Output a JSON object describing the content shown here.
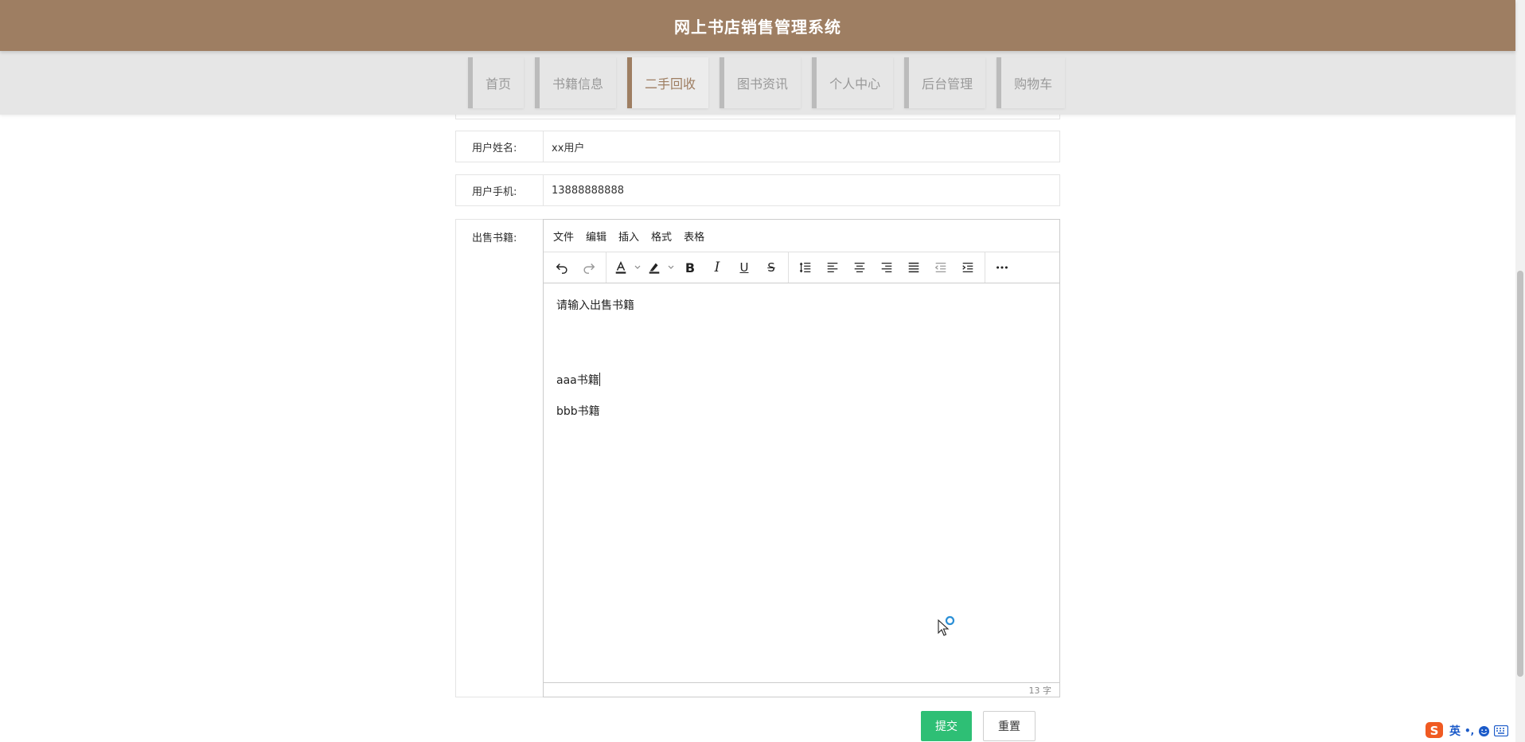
{
  "header": {
    "title": "网上书店销售管理系统"
  },
  "nav": {
    "items": [
      {
        "label": "首页",
        "active": false
      },
      {
        "label": "书籍信息",
        "active": false
      },
      {
        "label": "二手回收",
        "active": true
      },
      {
        "label": "图书资讯",
        "active": false
      },
      {
        "label": "个人中心",
        "active": false
      },
      {
        "label": "后台管理",
        "active": false
      },
      {
        "label": "购物车",
        "active": false
      }
    ]
  },
  "form": {
    "name_label": "用户姓名:",
    "name_value": "xx用户",
    "phone_label": "用户手机:",
    "phone_value": "13888888888",
    "books_label": "出售书籍:"
  },
  "editor": {
    "menus": [
      "文件",
      "编辑",
      "插入",
      "格式",
      "表格"
    ],
    "toolbar": [
      "undo-icon",
      "redo-icon",
      "font-color-icon",
      "highlight-icon",
      "bold-icon",
      "italic-icon",
      "underline-icon",
      "strikethrough-icon",
      "line-height-icon",
      "align-left-icon",
      "align-center-icon",
      "align-right-icon",
      "align-justify-icon",
      "outdent-icon",
      "indent-icon",
      "more-icon"
    ],
    "font_color_glyph": "A",
    "bold_glyph": "B",
    "italic_glyph": "I",
    "underline_glyph": "U",
    "strike_glyph": "S",
    "content": {
      "line1": "请输入出售书籍",
      "line2": "aaa书籍",
      "line3": "bbb书籍"
    },
    "word_count": "13 字"
  },
  "buttons": {
    "submit": "提交",
    "reset": "重置"
  },
  "ime": {
    "label": "英",
    "punct": "•,",
    "logo": "S"
  },
  "colors": {
    "header": "#9e7e62",
    "submit": "#2ebf75",
    "nav_bg": "#e6e6e6"
  }
}
